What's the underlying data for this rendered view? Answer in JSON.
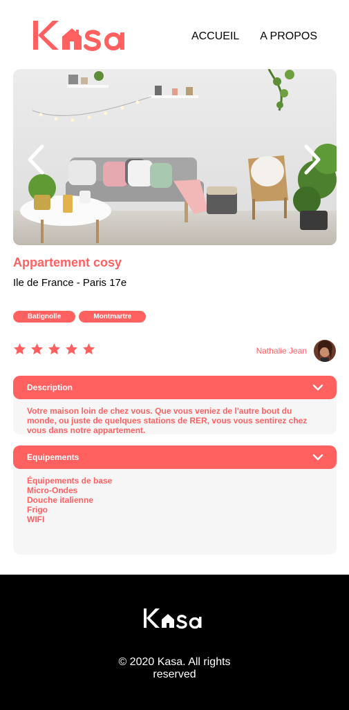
{
  "header": {
    "logo_text": "Kasa",
    "nav": [
      {
        "label": "ACCUEIL"
      },
      {
        "label": "A PROPOS"
      }
    ]
  },
  "carousel": {
    "photo": "living-room-photo",
    "left_arrow": "chevron-left-icon",
    "right_arrow": "chevron-right-icon"
  },
  "listing": {
    "title": "Appartement cosy",
    "location": "Ile de France - Paris 17e",
    "tags": [
      "Batignolle",
      "Montmartre"
    ],
    "rating": 5,
    "rating_max": 5,
    "host_name": "Nathalie Jean"
  },
  "description": {
    "title": "Description",
    "text": "Votre maison loin de chez vous. Que vous veniez de l'autre bout du monde, ou juste de quelques stations de RER, vous vous sentirez chez vous dans notre appartement."
  },
  "equipments": {
    "title": "Equipements",
    "items": [
      "Équipements de base",
      "Micro-Ondes",
      "Douche italienne",
      "Frigo",
      "WIFI"
    ]
  },
  "footer": {
    "logo_text": "Kasa",
    "copyright_line1": "© 2020 Kasa. All rights",
    "copyright_line2": "reserved"
  },
  "colors": {
    "accent": "#FF6060",
    "panel": "#F6F6F6",
    "footer_bg": "#000000"
  }
}
